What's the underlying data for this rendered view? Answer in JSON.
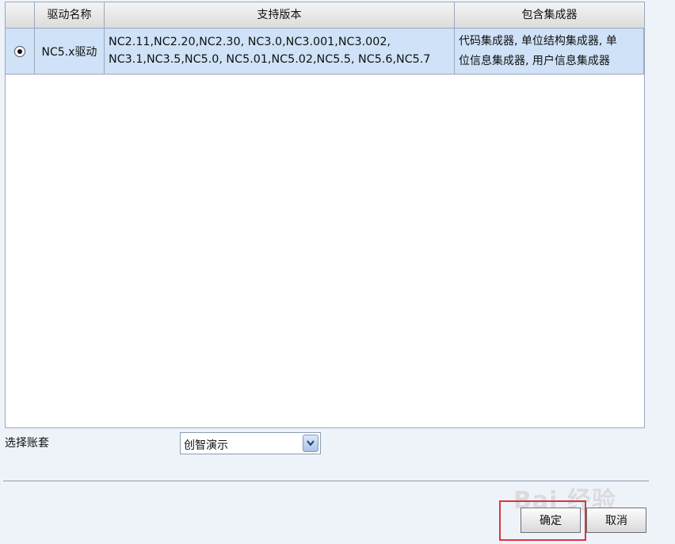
{
  "table": {
    "headers": [
      "",
      "驱动名称",
      "支持版本",
      "包含集成器"
    ],
    "rows": [
      {
        "selected": true,
        "driver": "NC5.x驱动",
        "versions_line1": "NC2.11,NC2.20,NC2.30, NC3.0,NC3.001,NC3.002,",
        "versions_line2": "NC3.1,NC3.5,NC5.0, NC5.01,NC5.02,NC5.5, NC5.6,NC5.7",
        "integrators_line1": "代码集成器, 单位结构集成器, 单",
        "integrators_line2": "位信息集成器, 用户信息集成器"
      }
    ]
  },
  "account": {
    "label": "选择账套",
    "selected": "创智演示"
  },
  "buttons": {
    "ok": "确定",
    "cancel": "取消"
  },
  "watermark": {
    "text": "Bai 经验",
    "url": "jingyan.baidu.com"
  },
  "colors": {
    "selected_row": "#cfe2f7",
    "highlight_box": "#d9363e",
    "background": "#eef3fa"
  }
}
